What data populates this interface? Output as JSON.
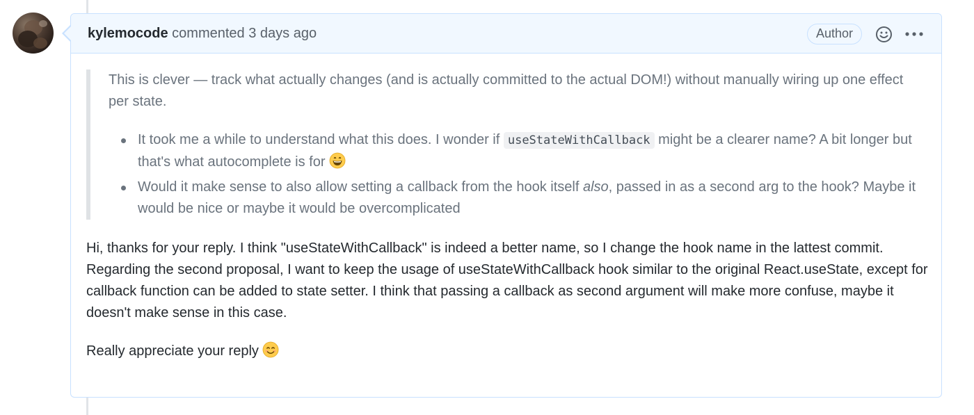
{
  "comment": {
    "author": "kylemocode",
    "action": "commented",
    "time": "3 days ago",
    "badge": "Author",
    "quote": {
      "paragraph": "This is clever — track what actually changes (and is actually committed to the actual DOM!) without manually wiring up one effect per state.",
      "items": [
        {
          "before": "It took me a while to understand what this does. I wonder if ",
          "code": "useStateWithCallback",
          "after": " might be a clearer name? A bit longer but that's what autocomplete is for ",
          "emoji": "grinning-face"
        },
        {
          "before": "Would it make sense to also allow setting a callback from the hook itself ",
          "emph": "also",
          "after": ", passed in as a second arg to the hook? Maybe it would be nice or maybe it would be overcomplicated"
        }
      ]
    },
    "reply": {
      "line1": "Hi, thanks for your reply. I think \"useStateWithCallback\" is indeed a better name, so I change the hook name in the lattest commit.",
      "line2": "Regarding the second proposal, I want to keep the usage of useStateWithCallback hook similar to the original React.useState, except for callback function can be added to state setter. I think that passing a callback as second argument will make more confuse, maybe it doesn't make sense in this case.",
      "closing": "Really appreciate your reply ",
      "closing_emoji": "smiling-face-with-smiling-eyes"
    }
  },
  "icons": {
    "reaction": "smiley-icon",
    "more": "kebab-horizontal-icon"
  },
  "colors": {
    "header_bg": "#f1f8ff",
    "border": "#c8e1ff",
    "quote_bar": "#dfe2e5",
    "muted_text": "#586069"
  }
}
